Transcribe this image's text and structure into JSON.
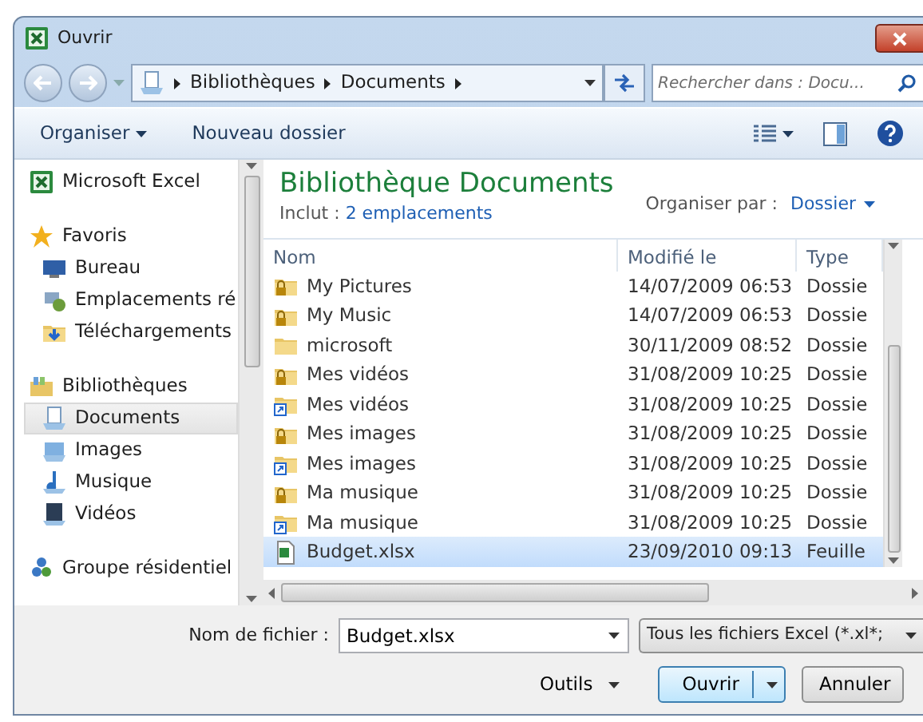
{
  "window": {
    "title": "Ouvrir"
  },
  "address": {
    "crumbs": [
      "Bibliothèques",
      "Documents"
    ],
    "search_placeholder": "Rechercher dans : Docu..."
  },
  "toolbar": {
    "organize": "Organiser",
    "new_folder": "Nouveau dossier"
  },
  "sidebar": {
    "items": [
      {
        "label": "Microsoft Excel",
        "kind": "excel",
        "selected": false
      },
      {
        "label": "Favoris",
        "kind": "star",
        "selected": false,
        "children": [
          {
            "label": "Bureau",
            "kind": "desktop",
            "selected": false
          },
          {
            "label": "Emplacements ré",
            "kind": "places",
            "selected": false
          },
          {
            "label": "Téléchargements",
            "kind": "download",
            "selected": false
          }
        ]
      },
      {
        "label": "Bibliothèques",
        "kind": "library",
        "selected": false,
        "children": [
          {
            "label": "Documents",
            "kind": "documents",
            "selected": true
          },
          {
            "label": "Images",
            "kind": "images",
            "selected": false
          },
          {
            "label": "Musique",
            "kind": "music",
            "selected": false
          },
          {
            "label": "Vidéos",
            "kind": "videos",
            "selected": false
          }
        ]
      },
      {
        "label": "Groupe résidentiel",
        "kind": "homegroup",
        "selected": false
      }
    ]
  },
  "library": {
    "title": "Bibliothèque Documents",
    "includes_label": "Inclut :",
    "includes_link": "2 emplacements",
    "arrange_label": "Organiser par :",
    "arrange_value": "Dossier"
  },
  "table": {
    "columns": [
      "Nom",
      "Modifié le",
      "Type"
    ],
    "rows": [
      {
        "kind": "locked-folder",
        "name": "My Pictures",
        "modified": "14/07/2009 06:53",
        "type": "Dossie",
        "selected": false
      },
      {
        "kind": "locked-folder",
        "name": "My Music",
        "modified": "14/07/2009 06:53",
        "type": "Dossie",
        "selected": false
      },
      {
        "kind": "folder",
        "name": "microsoft",
        "modified": "30/11/2009 08:52",
        "type": "Dossie",
        "selected": false
      },
      {
        "kind": "locked-folder",
        "name": "Mes vidéos",
        "modified": "31/08/2009 10:25",
        "type": "Dossie",
        "selected": false
      },
      {
        "kind": "shortcut-folder",
        "name": "Mes vidéos",
        "modified": "31/08/2009 10:25",
        "type": "Dossie",
        "selected": false
      },
      {
        "kind": "locked-folder",
        "name": "Mes images",
        "modified": "31/08/2009 10:25",
        "type": "Dossie",
        "selected": false
      },
      {
        "kind": "shortcut-folder",
        "name": "Mes images",
        "modified": "31/08/2009 10:25",
        "type": "Dossie",
        "selected": false
      },
      {
        "kind": "locked-folder",
        "name": "Ma musique",
        "modified": "31/08/2009 10:25",
        "type": "Dossie",
        "selected": false
      },
      {
        "kind": "shortcut-folder",
        "name": "Ma musique",
        "modified": "31/08/2009 10:25",
        "type": "Dossie",
        "selected": false
      },
      {
        "kind": "excel",
        "name": "Budget.xlsx",
        "modified": "23/09/2010 09:13",
        "type": "Feuille",
        "selected": true
      }
    ]
  },
  "footer": {
    "filename_label": "Nom de fichier :",
    "filename": "Budget.xlsx",
    "filter": "Tous les fichiers Excel (*.xl*;",
    "tools": "Outils",
    "open": "Ouvrir",
    "cancel": "Annuler"
  }
}
